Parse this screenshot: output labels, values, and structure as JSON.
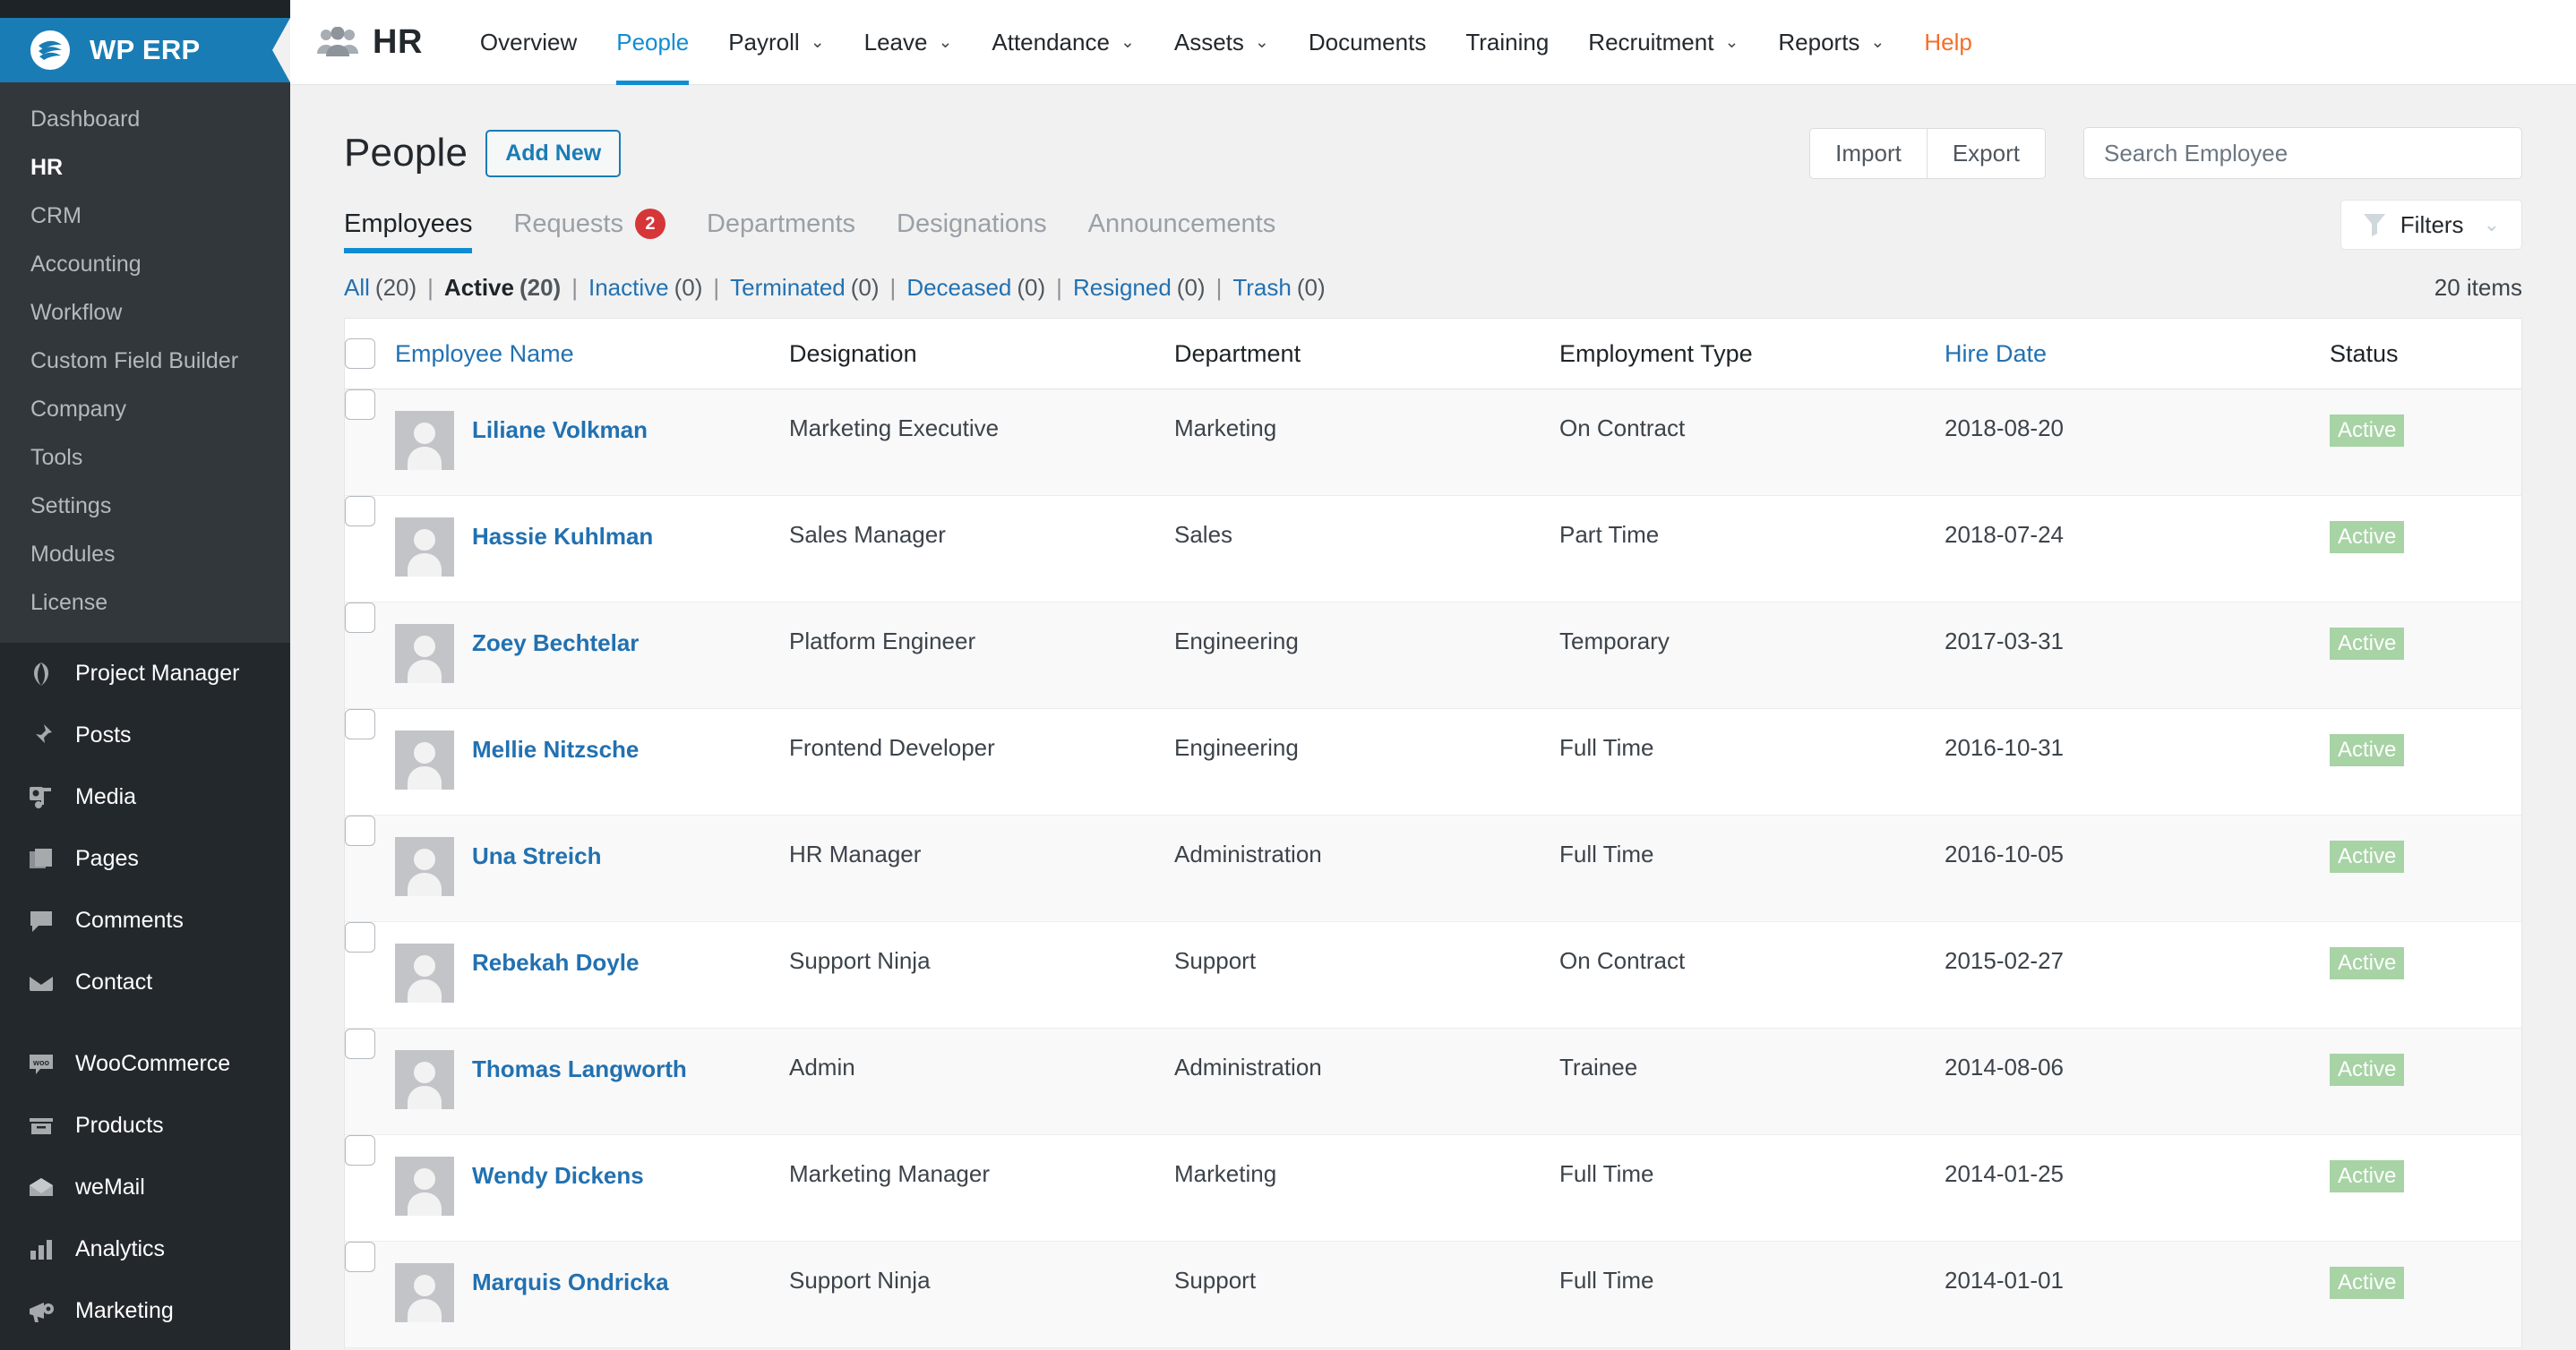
{
  "sidebar": {
    "brand": {
      "label": "WP ERP",
      "logo_icon": "wperp-logo-icon",
      "color": "#1a7cb5"
    },
    "erp_items": [
      {
        "label": "Dashboard",
        "current": false
      },
      {
        "label": "HR",
        "current": true
      },
      {
        "label": "CRM",
        "current": false
      },
      {
        "label": "Accounting",
        "current": false
      },
      {
        "label": "Workflow",
        "current": false
      },
      {
        "label": "Custom Field Builder",
        "current": false
      },
      {
        "label": "Company",
        "current": false
      },
      {
        "label": "Tools",
        "current": false
      },
      {
        "label": "Settings",
        "current": false
      },
      {
        "label": "Modules",
        "current": false
      },
      {
        "label": "License",
        "current": false
      }
    ],
    "wp_items": [
      {
        "label": "Project Manager",
        "icon": "project-manager-icon"
      },
      {
        "label": "Posts",
        "icon": "pin-icon"
      },
      {
        "label": "Media",
        "icon": "media-icon"
      },
      {
        "label": "Pages",
        "icon": "pages-icon"
      },
      {
        "label": "Comments",
        "icon": "comment-icon"
      },
      {
        "label": "Contact",
        "icon": "envelope-icon"
      },
      {
        "label": "WooCommerce",
        "icon": "woocommerce-icon"
      },
      {
        "label": "Products",
        "icon": "products-icon"
      },
      {
        "label": "weMail",
        "icon": "wemail-icon"
      },
      {
        "label": "Analytics",
        "icon": "analytics-icon"
      },
      {
        "label": "Marketing",
        "icon": "megaphone-icon"
      }
    ]
  },
  "navbar": {
    "module_icon": "people-group-icon",
    "module_title": "HR",
    "items": [
      {
        "label": "Overview",
        "has_caret": false,
        "active": false,
        "help": false
      },
      {
        "label": "People",
        "has_caret": false,
        "active": true,
        "help": false
      },
      {
        "label": "Payroll",
        "has_caret": true,
        "active": false,
        "help": false
      },
      {
        "label": "Leave",
        "has_caret": true,
        "active": false,
        "help": false
      },
      {
        "label": "Attendance",
        "has_caret": true,
        "active": false,
        "help": false
      },
      {
        "label": "Assets",
        "has_caret": true,
        "active": false,
        "help": false
      },
      {
        "label": "Documents",
        "has_caret": false,
        "active": false,
        "help": false
      },
      {
        "label": "Training",
        "has_caret": false,
        "active": false,
        "help": false
      },
      {
        "label": "Recruitment",
        "has_caret": true,
        "active": false,
        "help": false
      },
      {
        "label": "Reports",
        "has_caret": true,
        "active": false,
        "help": false
      },
      {
        "label": "Help",
        "has_caret": false,
        "active": false,
        "help": true
      }
    ],
    "caret_glyph": "⌄",
    "accent_color": "#0f8dd3",
    "help_color": "#f56e28"
  },
  "page": {
    "title": "People",
    "add_new_label": "Add New",
    "import_label": "Import",
    "export_label": "Export",
    "search_placeholder": "Search Employee",
    "search_value": ""
  },
  "tabs": [
    {
      "label": "Employees",
      "badge": "",
      "active": true
    },
    {
      "label": "Requests",
      "badge": "2",
      "active": false
    },
    {
      "label": "Departments",
      "badge": "",
      "active": false
    },
    {
      "label": "Designations",
      "badge": "",
      "active": false
    },
    {
      "label": "Announcements",
      "badge": "",
      "active": false
    }
  ],
  "filters_button": {
    "label": "Filters",
    "icon": "funnel-icon",
    "caret": "⌄"
  },
  "status_links": [
    {
      "label": "All",
      "count": "(20)",
      "current": false
    },
    {
      "label": "Active",
      "count": "(20)",
      "current": true
    },
    {
      "label": "Inactive",
      "count": "(0)",
      "current": false
    },
    {
      "label": "Terminated",
      "count": "(0)",
      "current": false
    },
    {
      "label": "Deceased",
      "count": "(0)",
      "current": false
    },
    {
      "label": "Resigned",
      "count": "(0)",
      "current": false
    },
    {
      "label": "Trash",
      "count": "(0)",
      "current": false
    }
  ],
  "items_count": "20 items",
  "table": {
    "columns": [
      {
        "label": "Employee Name",
        "sortable": true
      },
      {
        "label": "Designation",
        "sortable": false
      },
      {
        "label": "Department",
        "sortable": false
      },
      {
        "label": "Employment Type",
        "sortable": false
      },
      {
        "label": "Hire Date",
        "sortable": true
      },
      {
        "label": "Status",
        "sortable": false
      }
    ],
    "rows": [
      {
        "name": "Liliane Volkman",
        "designation": "Marketing Executive",
        "department": "Marketing",
        "employment_type": "On Contract",
        "hire_date": "2018-08-20",
        "status": "Active"
      },
      {
        "name": "Hassie Kuhlman",
        "designation": "Sales Manager",
        "department": "Sales",
        "employment_type": "Part Time",
        "hire_date": "2018-07-24",
        "status": "Active"
      },
      {
        "name": "Zoey Bechtelar",
        "designation": "Platform Engineer",
        "department": "Engineering",
        "employment_type": "Temporary",
        "hire_date": "2017-03-31",
        "status": "Active"
      },
      {
        "name": "Mellie Nitzsche",
        "designation": "Frontend Developer",
        "department": "Engineering",
        "employment_type": "Full Time",
        "hire_date": "2016-10-31",
        "status": "Active"
      },
      {
        "name": "Una Streich",
        "designation": "HR Manager",
        "department": "Administration",
        "employment_type": "Full Time",
        "hire_date": "2016-10-05",
        "status": "Active"
      },
      {
        "name": "Rebekah Doyle",
        "designation": "Support Ninja",
        "department": "Support",
        "employment_type": "On Contract",
        "hire_date": "2015-02-27",
        "status": "Active"
      },
      {
        "name": "Thomas Langworth",
        "designation": "Admin",
        "department": "Administration",
        "employment_type": "Trainee",
        "hire_date": "2014-08-06",
        "status": "Active"
      },
      {
        "name": "Wendy Dickens",
        "designation": "Marketing Manager",
        "department": "Marketing",
        "employment_type": "Full Time",
        "hire_date": "2014-01-25",
        "status": "Active"
      },
      {
        "name": "Marquis Ondricka",
        "designation": "Support Ninja",
        "department": "Support",
        "employment_type": "Full Time",
        "hire_date": "2014-01-01",
        "status": "Active"
      }
    ]
  },
  "colors": {
    "brand_blue": "#1a7cb5",
    "link_blue": "#2271b1",
    "accent": "#0f8dd3",
    "badge_green": "#a7d3a5",
    "badge_red": "#d63638",
    "help_orange": "#f56e28"
  }
}
